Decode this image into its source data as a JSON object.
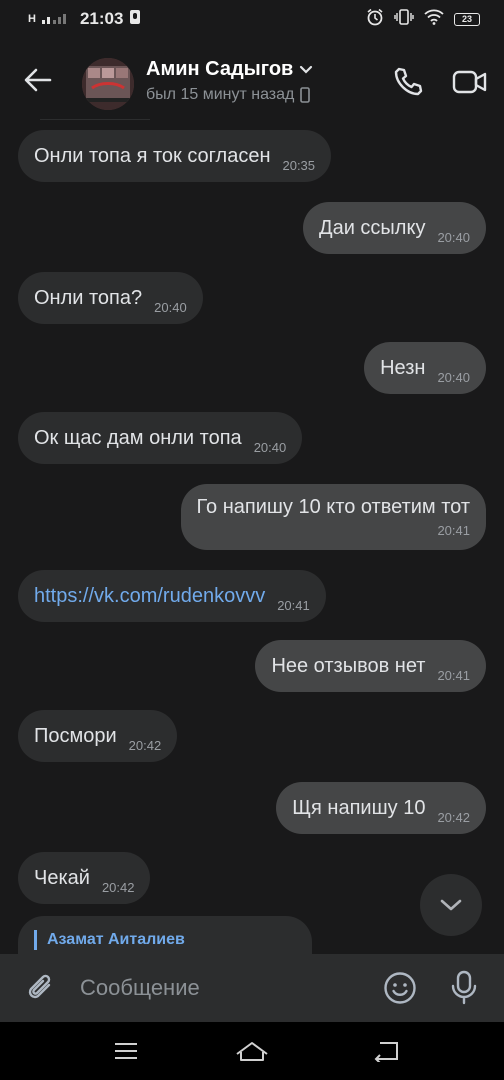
{
  "status_bar": {
    "network": "H",
    "time": "21:03",
    "battery": "23"
  },
  "header": {
    "peer_name": "Амин Садыгов",
    "peer_status": "был 15 минут назад"
  },
  "messages": [
    {
      "dir": "in",
      "text": "Онли топа я ток согласен",
      "time": "20:35"
    },
    {
      "dir": "out",
      "text": "Даи ссылку",
      "time": "20:40"
    },
    {
      "dir": "in",
      "text": "Онли топа?",
      "time": "20:40"
    },
    {
      "dir": "out",
      "text": "Незн",
      "time": "20:40"
    },
    {
      "dir": "in",
      "text": "Ок щас дам онли топа",
      "time": "20:40"
    },
    {
      "dir": "out",
      "text": "Го напишу 10 кто ответим тот",
      "time": "20:41"
    },
    {
      "dir": "in",
      "text": "https://vk.com/rudenkovvv",
      "time": "20:41",
      "is_link": true
    },
    {
      "dir": "out",
      "text": "Нее отзывов нет",
      "time": "20:41"
    },
    {
      "dir": "in",
      "text": "Посмори",
      "time": "20:42"
    },
    {
      "dir": "out",
      "text": "Щя напишу 10",
      "time": "20:42"
    },
    {
      "dir": "in",
      "text": "Чекай",
      "time": "20:42"
    }
  ],
  "partial_message": {
    "reply_author": "Азамат Аиталиев"
  },
  "composer": {
    "placeholder": "Сообщение"
  },
  "colors": {
    "background": "#19191a",
    "bubble_in": "#2c2d2e",
    "bubble_out": "#454647",
    "link": "#71aaeb",
    "muted": "#8c9196"
  },
  "icons": {
    "back": "arrow-left-icon",
    "call": "phone-icon",
    "video": "video-camera-icon",
    "attach": "paperclip-icon",
    "emoji": "smile-icon",
    "mic": "microphone-icon",
    "scroll": "chevron-down-icon"
  }
}
